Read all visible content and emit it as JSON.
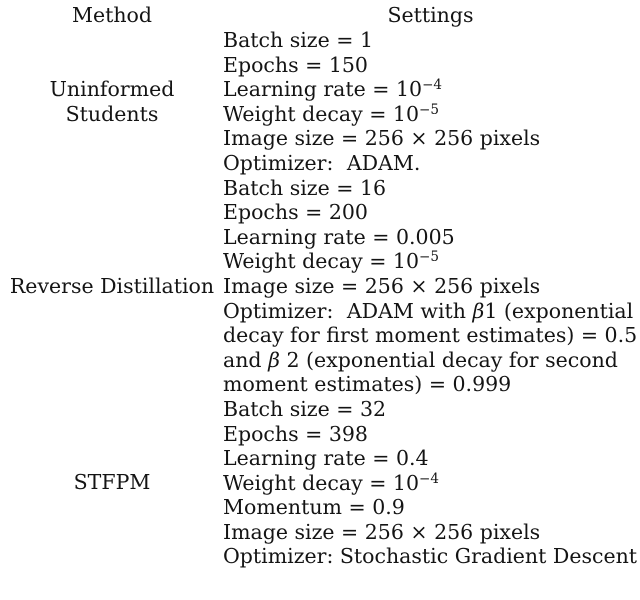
{
  "table": {
    "columns": [
      "Method",
      "Settings"
    ],
    "rows": [
      {
        "method_lines": [
          "Uninformed",
          "Students"
        ],
        "method_plain": "Uninformed Students",
        "settings": [
          {
            "label": "Batch size",
            "sep": "=",
            "value": "1",
            "text": "Batch size = 1"
          },
          {
            "label": "Epochs",
            "sep": "=",
            "value": "150",
            "text": "Epochs = 150"
          },
          {
            "label": "Learning rate",
            "sep": "=",
            "value": "10^-4",
            "text": "Learning rate = 10⁻⁴"
          },
          {
            "label": "Weight decay",
            "sep": "=",
            "value": "10^-5",
            "text": "Weight decay = 10⁻⁵"
          },
          {
            "label": "Image size",
            "sep": "=",
            "value": "256 × 256 pixels",
            "text": "Image size = 256 × 256 pixels"
          },
          {
            "label": "Optimizer:",
            "sep": "",
            "value": "ADAM.",
            "text": "Optimizer:  ADAM."
          }
        ]
      },
      {
        "method_lines": [
          "Reverse Distillation"
        ],
        "method_plain": "Reverse Distillation",
        "settings": [
          {
            "label": "Batch size",
            "sep": "=",
            "value": "16",
            "text": "Batch size = 16"
          },
          {
            "label": "Epochs",
            "sep": "=",
            "value": "200",
            "text": "Epochs = 200"
          },
          {
            "label": "Learning rate",
            "sep": "=",
            "value": "0.005",
            "text": "Learning rate = 0.005"
          },
          {
            "label": "Weight decay",
            "sep": "=",
            "value": "10^-5",
            "text": "Weight decay = 10⁻⁵"
          },
          {
            "label": "Image size",
            "sep": "=",
            "value": "256 × 256 pixels",
            "text": "Image size = 256 × 256 pixels"
          },
          {
            "label": "Optimizer:",
            "sep": "",
            "value": "ADAM with β1 (exponential decay for first moment estimates) = 0.5 and β 2 (exponential decay for second moment estimates) = 0.999",
            "text": "Optimizer:  ADAM with β1 (exponential decay for first moment estimates) = 0.5 and β 2 (exponential decay for second moment estimates) = 0.999"
          }
        ]
      },
      {
        "method_lines": [
          "STFPM"
        ],
        "method_plain": "STFPM",
        "settings": [
          {
            "label": "Batch size",
            "sep": "=",
            "value": "32",
            "text": "Batch size = 32"
          },
          {
            "label": "Epochs",
            "sep": "=",
            "value": "398",
            "text": "Epochs = 398"
          },
          {
            "label": "Learning rate",
            "sep": "=",
            "value": "0.4",
            "text": "Learning rate = 0.4"
          },
          {
            "label": "Weight decay",
            "sep": "=",
            "value": "10^-4",
            "text": "Weight decay = 10⁻⁴"
          },
          {
            "label": "Momentum",
            "sep": "=",
            "value": "0.9",
            "text": "Momentum = 0.9"
          },
          {
            "label": "Image size",
            "sep": "=",
            "value": "256 × 256 pixels",
            "text": "Image size = 256 × 256 pixels"
          },
          {
            "label": "Optimizer:",
            "sep": "",
            "value": "Stochastic Gradient Descent",
            "text": "Optimizer: Stochastic Gradient Descent"
          }
        ]
      }
    ]
  },
  "r0": {
    "m0": "Uninformed",
    "m1": "Students",
    "s0": "Batch size = 1",
    "s1": "Epochs = 150",
    "s2a": "Learning rate = 10",
    "s2b": "−4",
    "s3a": "Weight decay = 10",
    "s3b": "−5",
    "s4": "Image size = 256 × 256 pixels",
    "s5a": "Optimizer:",
    "s5b": "ADAM."
  },
  "r1": {
    "m0": "Reverse Distillation",
    "s0": "Batch size = 16",
    "s1": "Epochs = 200",
    "s2": "Learning rate = 0.005",
    "s3a": "Weight decay = 10",
    "s3b": "−5",
    "s4": "Image size = 256 × 256 pixels",
    "s5a": "Optimizer:",
    "s5b": "ADAM with",
    "s5c": "β",
    "s5d": "1 (exponential decay for first moment estimates) = 0.5 and",
    "s5e": "β",
    "s5f": "2 (exponential decay for second moment estimates) = 0.999"
  },
  "r2": {
    "m0": "STFPM",
    "s0": "Batch size = 32",
    "s1": "Epochs = 398",
    "s2": "Learning rate = 0.4",
    "s3a": "Weight decay = 10",
    "s3b": "−4",
    "s4": "Momentum = 0.9",
    "s5": "Image size = 256 × 256 pixels",
    "s6": "Optimizer: Stochastic Gradient Descent"
  }
}
